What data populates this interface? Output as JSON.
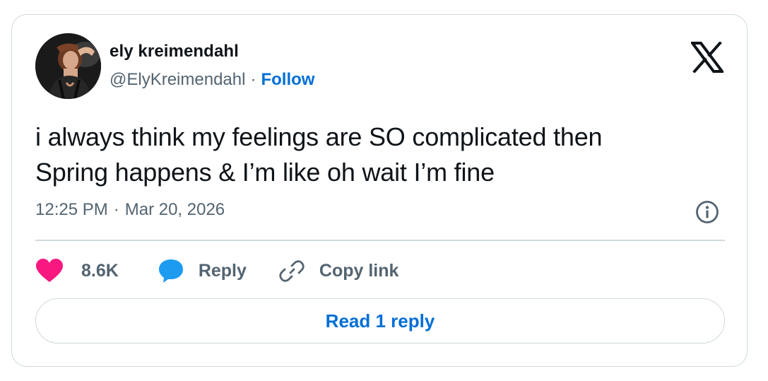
{
  "author": {
    "name": "ely kreimendahl",
    "handle": "@ElyKreimendahl",
    "separator": "·",
    "follow_label": "Follow"
  },
  "tweet": {
    "text_lines": [
      "i always think my feelings are SO complicated then",
      "Spring happens & I’m like oh wait I’m fine"
    ],
    "time": "12:25 PM",
    "separator": "·",
    "date": "Mar 20, 2026"
  },
  "actions": {
    "like_count": "8.6K",
    "reply_label": "Reply",
    "copy_link_label": "Copy link"
  },
  "footer": {
    "read_replies_label": "Read 1 reply"
  },
  "icons": {
    "brand": "x-logo-icon",
    "info": "info-icon",
    "like": "heart-icon",
    "reply": "speech-bubble-icon",
    "copy": "link-icon"
  },
  "colors": {
    "like": "#f91880",
    "reply": "#1d9bf0",
    "link_blue": "#006fd6",
    "muted": "#536471",
    "border": "#cfd9de"
  }
}
